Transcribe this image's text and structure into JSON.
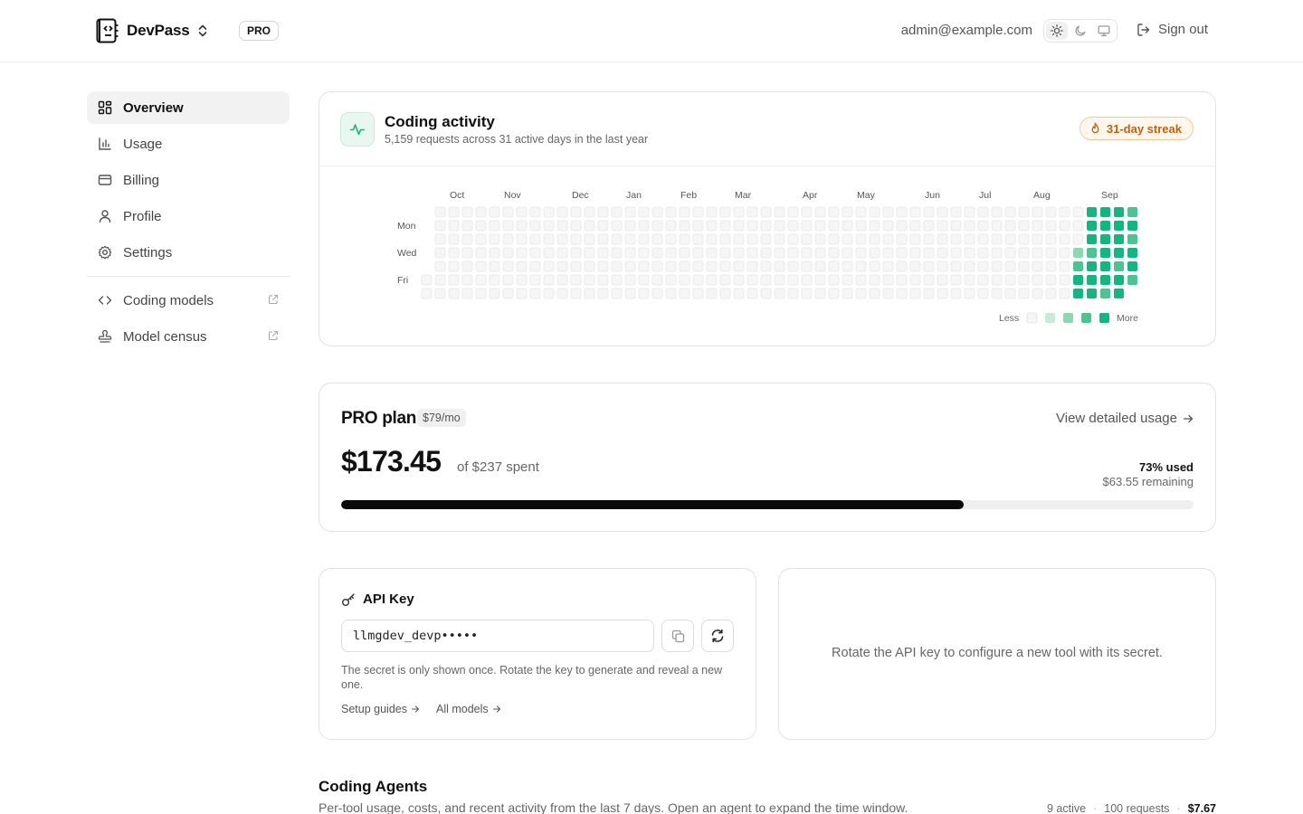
{
  "header": {
    "app_name": "DevPass",
    "plan_badge": "PRO",
    "user_email": "admin@example.com",
    "theme_options": [
      "light",
      "dark",
      "system"
    ],
    "theme_selected": "light",
    "sign_out_label": "Sign out"
  },
  "sidebar": {
    "items": [
      {
        "label": "Overview",
        "icon": "grid-icon"
      },
      {
        "label": "Usage",
        "icon": "bar-chart-icon"
      },
      {
        "label": "Billing",
        "icon": "credit-card-icon"
      },
      {
        "label": "Profile",
        "icon": "user-icon"
      },
      {
        "label": "Settings",
        "icon": "gear-icon"
      }
    ],
    "external": [
      {
        "label": "Coding models",
        "icon": "code-icon"
      },
      {
        "label": "Model census",
        "icon": "stamp-icon"
      }
    ]
  },
  "activity": {
    "title": "Coding activity",
    "subtitle": "5,159 requests across 31 active days in the last year",
    "streak": "31-day streak",
    "months": [
      "Oct",
      "Nov",
      "Dec",
      "Jan",
      "Feb",
      "Mar",
      "Apr",
      "May",
      "Jun",
      "Jul",
      "Aug",
      "Sep"
    ],
    "day_labels": [
      "Mon",
      "Wed",
      "Fri"
    ],
    "legend_less": "Less",
    "legend_more": "More",
    "colors": [
      "#f6f6f6",
      "#c4ecd8",
      "#8ad9b4",
      "#48c592",
      "#10b77f"
    ],
    "active_cells": [
      {
        "week": 48,
        "day": 3,
        "level": 2
      },
      {
        "week": 48,
        "day": 4,
        "level": 3
      },
      {
        "week": 48,
        "day": 5,
        "level": 4
      },
      {
        "week": 48,
        "day": 6,
        "level": 4
      },
      {
        "week": 49,
        "day": 0,
        "level": 4
      },
      {
        "week": 49,
        "day": 1,
        "level": 4
      },
      {
        "week": 49,
        "day": 2,
        "level": 4
      },
      {
        "week": 49,
        "day": 3,
        "level": 3
      },
      {
        "week": 49,
        "day": 4,
        "level": 4
      },
      {
        "week": 49,
        "day": 5,
        "level": 4
      },
      {
        "week": 49,
        "day": 6,
        "level": 4
      },
      {
        "week": 50,
        "day": 0,
        "level": 4
      },
      {
        "week": 50,
        "day": 1,
        "level": 4
      },
      {
        "week": 50,
        "day": 2,
        "level": 4
      },
      {
        "week": 50,
        "day": 3,
        "level": 4
      },
      {
        "week": 50,
        "day": 4,
        "level": 4
      },
      {
        "week": 50,
        "day": 5,
        "level": 4
      },
      {
        "week": 50,
        "day": 6,
        "level": 3
      },
      {
        "week": 51,
        "day": 0,
        "level": 4
      },
      {
        "week": 51,
        "day": 1,
        "level": 4
      },
      {
        "week": 51,
        "day": 2,
        "level": 4
      },
      {
        "week": 51,
        "day": 3,
        "level": 4
      },
      {
        "week": 51,
        "day": 4,
        "level": 3
      },
      {
        "week": 51,
        "day": 5,
        "level": 4
      },
      {
        "week": 51,
        "day": 6,
        "level": 4
      },
      {
        "week": 52,
        "day": 0,
        "level": 3
      },
      {
        "week": 52,
        "day": 1,
        "level": 4
      },
      {
        "week": 52,
        "day": 2,
        "level": 3
      },
      {
        "week": 52,
        "day": 3,
        "level": 4
      },
      {
        "week": 52,
        "day": 4,
        "level": 4
      },
      {
        "week": 52,
        "day": 5,
        "level": 3
      }
    ]
  },
  "plan": {
    "title": "PRO plan",
    "price": "$79/mo",
    "usage_link": "View detailed usage",
    "spent": "$173.45",
    "spent_of": "of $237 spent",
    "pct_used_label": "73% used",
    "pct_used": 0.73,
    "remaining": "$63.55 remaining"
  },
  "api_key": {
    "title": "API Key",
    "value": "llmgdev_devp•••••",
    "note": "The secret is only shown once. Rotate the key to generate and reveal a new one.",
    "links": [
      "Setup guides",
      "All models"
    ]
  },
  "rotate_panel": {
    "message": "Rotate the API key to configure a new tool with its secret."
  },
  "agents": {
    "title": "Coding Agents",
    "subtitle": "Per-tool usage, costs, and recent activity from the last 7 days. Open an agent to expand the time window.",
    "active": "9 active",
    "requests": "100 requests",
    "cost": "$7.67"
  }
}
